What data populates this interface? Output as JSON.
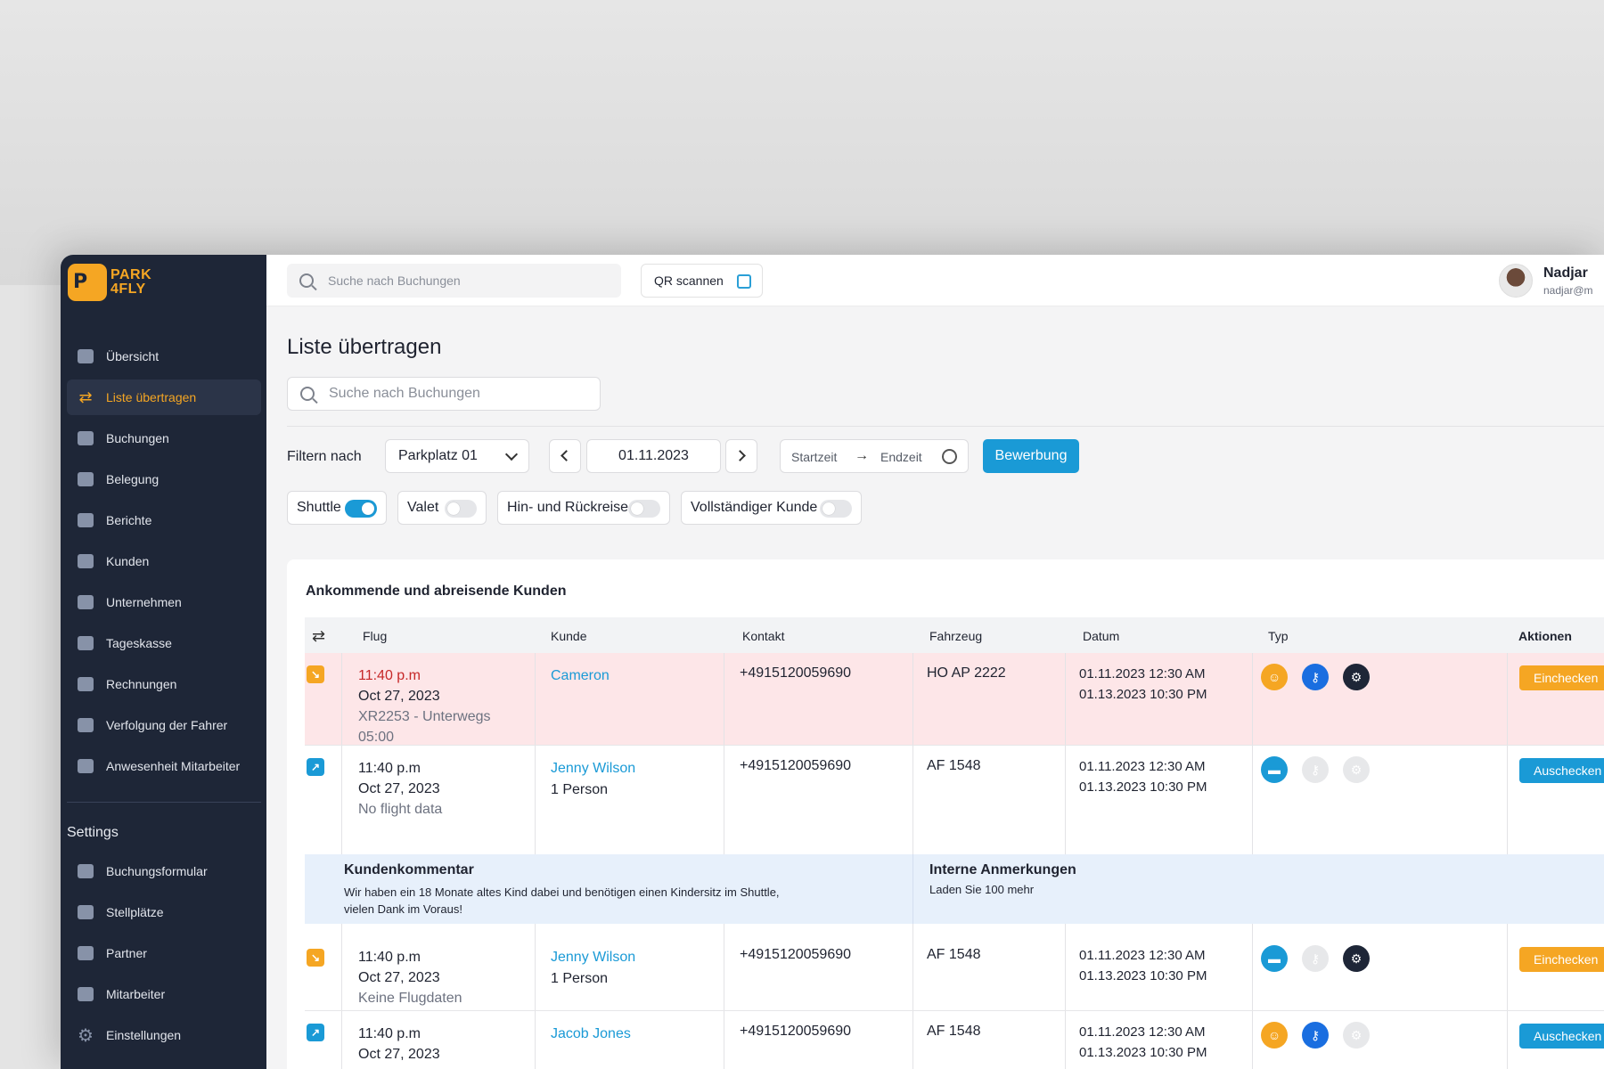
{
  "brand": {
    "line1": "PARK",
    "line2": "4FLY",
    "badge": "P"
  },
  "sidebar": {
    "items": [
      {
        "label": "Übersicht",
        "icon": "dashboard-icon"
      },
      {
        "label": "Liste übertragen",
        "icon": "transfer-icon",
        "active": true
      },
      {
        "label": "Buchungen",
        "icon": "bookings-icon"
      },
      {
        "label": "Belegung",
        "icon": "calendar-icon"
      },
      {
        "label": "Berichte",
        "icon": "chart-icon"
      },
      {
        "label": "Kunden",
        "icon": "customers-icon"
      },
      {
        "label": "Unternehmen",
        "icon": "building-icon"
      },
      {
        "label": "Tageskasse",
        "icon": "cash-icon"
      },
      {
        "label": "Rechnungen",
        "icon": "invoice-icon"
      },
      {
        "label": "Verfolgung der Fahrer",
        "icon": "driver-icon"
      },
      {
        "label": "Anwesenheit Mitarbeiter",
        "icon": "attendance-icon"
      }
    ],
    "settings_title": "Settings",
    "settings_items": [
      {
        "label": "Buchungsformular",
        "icon": "form-icon"
      },
      {
        "label": "Stellplätze",
        "icon": "parking-icon"
      },
      {
        "label": "Partner",
        "icon": "partner-icon"
      },
      {
        "label": "Mitarbeiter",
        "icon": "staff-icon"
      },
      {
        "label": "Einstellungen",
        "icon": "gear-icon"
      }
    ]
  },
  "topbar": {
    "search_placeholder": "Suche nach Buchungen",
    "qr_label": "QR scannen",
    "user_name": "Nadjar",
    "user_email": "nadjar@m"
  },
  "main": {
    "title": "Liste übertragen",
    "search_placeholder": "Suche nach Buchungen",
    "filter_label": "Filtern nach",
    "parking_select": "Parkplatz 01",
    "date": "01.11.2023",
    "start_label": "Startzeit",
    "end_label": "Endzeit",
    "primary_button": "Bewerbung",
    "toggles": [
      {
        "label": "Shuttle",
        "on": true
      },
      {
        "label": "Valet",
        "on": false
      },
      {
        "label": "Hin- und Rückreise",
        "on": false
      },
      {
        "label": "Vollständiger Kunde",
        "on": false
      }
    ]
  },
  "table": {
    "title": "Ankommende und abreisende Kunden",
    "headers": {
      "flug": "Flug",
      "kunde": "Kunde",
      "kontakt": "Kontakt",
      "fahrzeug": "Fahrzeug",
      "datum": "Datum",
      "typ": "Typ",
      "aktionen": "Aktionen"
    },
    "rows": [
      {
        "time": "11:40 p.m",
        "date": "Oct 27, 2023",
        "flight": "XR2253 - Unterwegs",
        "flight2": "05:00",
        "customer": "Cameron",
        "persons": "",
        "contact": "+4915120059690",
        "vehicle": "HO AP 2222",
        "d1": "01.11.2023  12:30 AM",
        "d2": "01.13.2023 10:30 PM",
        "action": "Einchecken"
      },
      {
        "time": "11:40 p.m",
        "date": "Oct 27, 2023",
        "flight": "No flight data",
        "flight2": "",
        "customer": "Jenny Wilson",
        "persons": "1 Person",
        "contact": "+4915120059690",
        "vehicle": "AF 1548",
        "d1": "01.11.2023  12:30 AM",
        "d2": "01.13.2023  10:30 PM",
        "action": "Auschecken"
      },
      {
        "time": "11:40 p.m",
        "date": "Oct 27, 2023",
        "flight": "Keine Flugdaten",
        "flight2": "",
        "customer": "Jenny Wilson",
        "persons": "1 Person",
        "contact": "+4915120059690",
        "vehicle": "AF 1548",
        "d1": "01.11.2023  12:30 AM",
        "d2": "01.13.2023  10:30 PM",
        "action": "Einchecken"
      },
      {
        "time": "11:40 p.m",
        "date": "Oct 27, 2023",
        "flight": "",
        "flight2": "",
        "customer": "Jacob Jones",
        "persons": "",
        "contact": "+4915120059690",
        "vehicle": "AF 1548",
        "d1": "01.11.2023  12:30 AM",
        "d2": "01.13.2023  10:30 PM",
        "action": "Auschecken"
      }
    ],
    "comment": {
      "customer_title": "Kundenkommentar",
      "customer_text1": "Wir haben ein 18 Monate altes Kind dabei und benötigen einen Kindersitz im Shuttle,",
      "customer_text2": "vielen Dank im Voraus!",
      "internal_title": "Interne Anmerkungen",
      "internal_text": "Laden Sie 100 mehr"
    }
  },
  "colors": {
    "accent": "#1a9ad6",
    "orange": "#f5a623",
    "sidebar": "#1e2637",
    "alert_row": "#fde6e8"
  }
}
